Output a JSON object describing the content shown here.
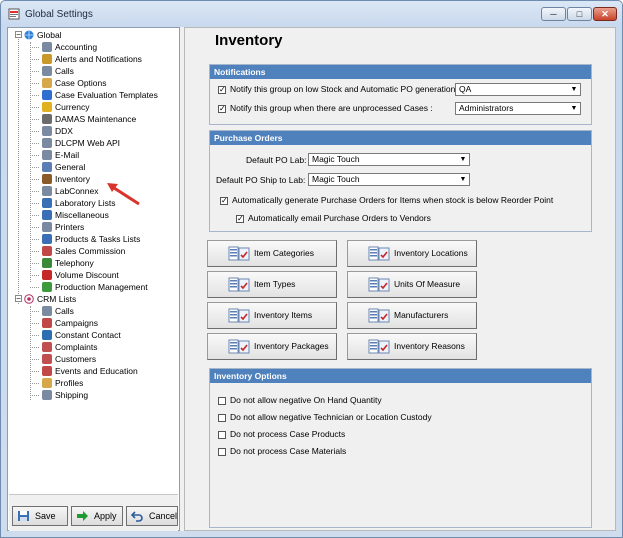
{
  "window": {
    "title": "Global Settings",
    "minimize": "─",
    "maximize": "□",
    "close": "✕"
  },
  "tree": {
    "global": {
      "label": "Global",
      "icon": "globe-icon"
    },
    "global_items": [
      {
        "label": "Accounting",
        "icon": "wrench-icon"
      },
      {
        "label": "Alerts and Notifications",
        "icon": "bell-icon"
      },
      {
        "label": "Calls",
        "icon": "wrench-icon"
      },
      {
        "label": "Case Options",
        "icon": "document-icon"
      },
      {
        "label": "Case Evaluation Templates",
        "icon": "star-icon"
      },
      {
        "label": "Currency",
        "icon": "coin-icon"
      },
      {
        "label": "DAMAS Maintenance",
        "icon": "tools-icon"
      },
      {
        "label": "DDX",
        "icon": "wrench-icon"
      },
      {
        "label": "DLCPM Web API",
        "icon": "wrench-icon"
      },
      {
        "label": "E-Mail",
        "icon": "wrench-icon"
      },
      {
        "label": "General",
        "icon": "window-icon"
      },
      {
        "label": "Inventory",
        "icon": "inventory-icon"
      },
      {
        "label": "LabConnex",
        "icon": "wrench-icon"
      },
      {
        "label": "Laboratory Lists",
        "icon": "list-icon"
      },
      {
        "label": "Miscellaneous",
        "icon": "list-icon"
      },
      {
        "label": "Printers",
        "icon": "wrench-icon"
      },
      {
        "label": "Products & Tasks Lists",
        "icon": "list-icon"
      },
      {
        "label": "Sales Commission",
        "icon": "people-icon"
      },
      {
        "label": "Telephony",
        "icon": "phone-icon"
      },
      {
        "label": "Volume Discount",
        "icon": "percent-icon"
      },
      {
        "label": "Production Management",
        "icon": "gear-icon"
      }
    ],
    "crm": {
      "label": "CRM Lists",
      "icon": "crm-icon"
    },
    "crm_items": [
      {
        "label": "Calls",
        "icon": "wrench-icon"
      },
      {
        "label": "Campaigns",
        "icon": "people-icon"
      },
      {
        "label": "Constant Contact",
        "icon": "contact-icon"
      },
      {
        "label": "Complaints",
        "icon": "person-icon"
      },
      {
        "label": "Customers",
        "icon": "person-icon"
      },
      {
        "label": "Events and Education",
        "icon": "people-icon"
      },
      {
        "label": "Profiles",
        "icon": "document-icon"
      },
      {
        "label": "Shipping",
        "icon": "wrench-icon"
      }
    ],
    "selected": "Inventory"
  },
  "buttons": {
    "save": "Save",
    "apply": "Apply",
    "cancel": "Cancel"
  },
  "page": {
    "title": "Inventory"
  },
  "notifications": {
    "header": "Notifications",
    "low_stock_label": "Notify this group on low Stock and Automatic PO generation:",
    "low_stock_checked": true,
    "low_stock_value": "QA",
    "unprocessed_label": "Notify this group when there are unprocessed Cases :",
    "unprocessed_checked": true,
    "unprocessed_value": "Administrators"
  },
  "purchase_orders": {
    "header": "Purchase Orders",
    "default_lab_label": "Default PO Lab:",
    "default_lab_value": "Magic Touch",
    "ship_to_label": "Default PO Ship to Lab:",
    "ship_to_value": "Magic Touch",
    "auto_generate_label": "Automatically generate Purchase Orders for Items when stock is below Reorder Point",
    "auto_generate_checked": true,
    "auto_email_label": "Automatically email Purchase Orders to Vendors",
    "auto_email_checked": true
  },
  "tiles": [
    {
      "label": "Item Categories"
    },
    {
      "label": "Inventory Locations"
    },
    {
      "label": "Item Types"
    },
    {
      "label": "Units Of Measure"
    },
    {
      "label": "Inventory Items"
    },
    {
      "label": "Manufacturers"
    },
    {
      "label": "Inventory Packages"
    },
    {
      "label": "Inventory Reasons"
    }
  ],
  "inventory_options": {
    "header": "Inventory Options",
    "items": [
      {
        "label": "Do not allow negative On Hand Quantity",
        "checked": false
      },
      {
        "label": "Do not allow negative Technician or Location Custody",
        "checked": false
      },
      {
        "label": "Do not process Case Products",
        "checked": false
      },
      {
        "label": "Do not process Case Materials",
        "checked": false
      }
    ]
  },
  "colors": {
    "header_blue": "#4f81bd",
    "selection_blue": "#3399ff",
    "arrow_red": "#d9342b"
  }
}
